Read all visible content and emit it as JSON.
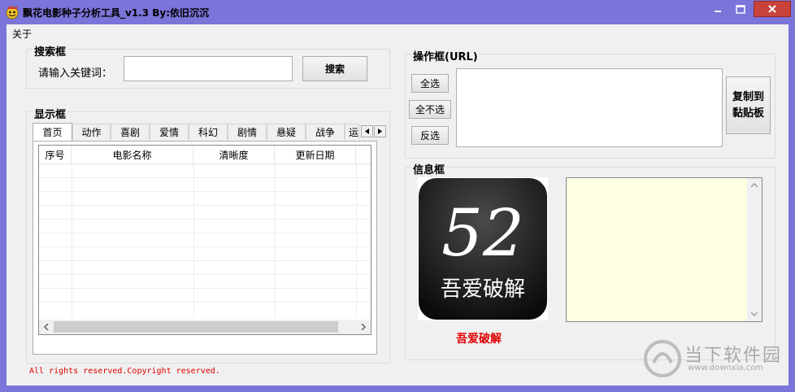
{
  "window": {
    "title": "飘花电影种子分析工具_v1.3 By:依旧沉沉"
  },
  "menu": {
    "about": "关于"
  },
  "search": {
    "group_title": "搜索框",
    "keyword_label": "请输入关键词：",
    "keyword_value": "",
    "search_button": "搜索"
  },
  "display": {
    "group_title": "显示框",
    "tabs": [
      "首页",
      "动作",
      "喜剧",
      "爱情",
      "科幻",
      "剧情",
      "悬疑",
      "战争",
      "运"
    ],
    "columns": [
      "序号",
      "电影名称",
      "清晰度",
      "更新日期"
    ]
  },
  "operation": {
    "group_title": "操作框(URL)",
    "select_all": "全选",
    "select_none": "全不选",
    "invert_selection": "反选",
    "copy_to_clipboard_line1": "复制到",
    "copy_to_clipboard_line2": "黏贴板",
    "url_text": ""
  },
  "info": {
    "group_title": "信息框",
    "logo_number": "52",
    "logo_text": "吾爱破解",
    "caption": "吾爱破解",
    "info_text": ""
  },
  "footer": {
    "copyright": "All rights reserved.Copyright reserved."
  },
  "watermark": {
    "name": "当下软件园",
    "url": "www.downxia.com"
  },
  "colors": {
    "titlebar": "#7b74d9",
    "close": "#c8423c",
    "caption_red": "#e00000",
    "info_bg": "#ffffe1"
  }
}
